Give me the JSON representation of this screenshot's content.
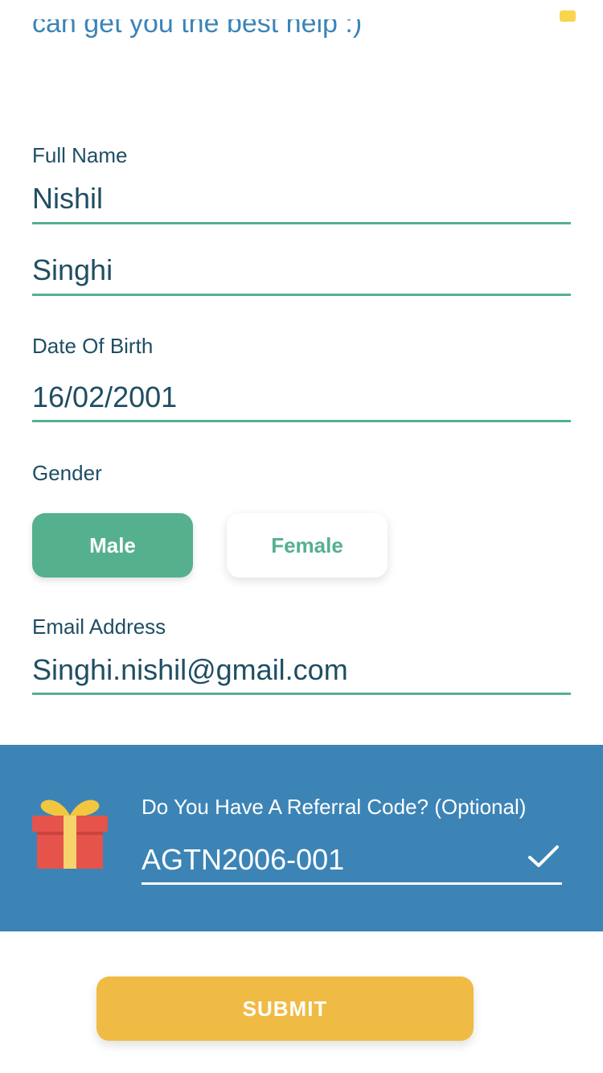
{
  "intro_text": "can get you the best help :)",
  "form": {
    "full_name_label": "Full Name",
    "first_name": "Nishil",
    "last_name": "Singhi",
    "dob_label": "Date Of Birth",
    "dob": "16/02/2001",
    "gender_label": "Gender",
    "gender_options": [
      "Male",
      "Female"
    ],
    "gender_selected": "Male",
    "email_label": "Email Address",
    "email": "Singhi.nishil@gmail.com"
  },
  "referral": {
    "label": "Do You Have A Referral Code? (Optional)",
    "code": "AGTN2006-001",
    "icon": "gift-icon",
    "status_icon": "checkmark-icon"
  },
  "submit_label": "SUBMIT",
  "colors": {
    "accent_green": "#55b08e",
    "text_dark": "#1f4e63",
    "referral_blue": "#3c84b6",
    "submit_yellow": "#f0bb44",
    "intro_blue": "#3a84b8"
  }
}
